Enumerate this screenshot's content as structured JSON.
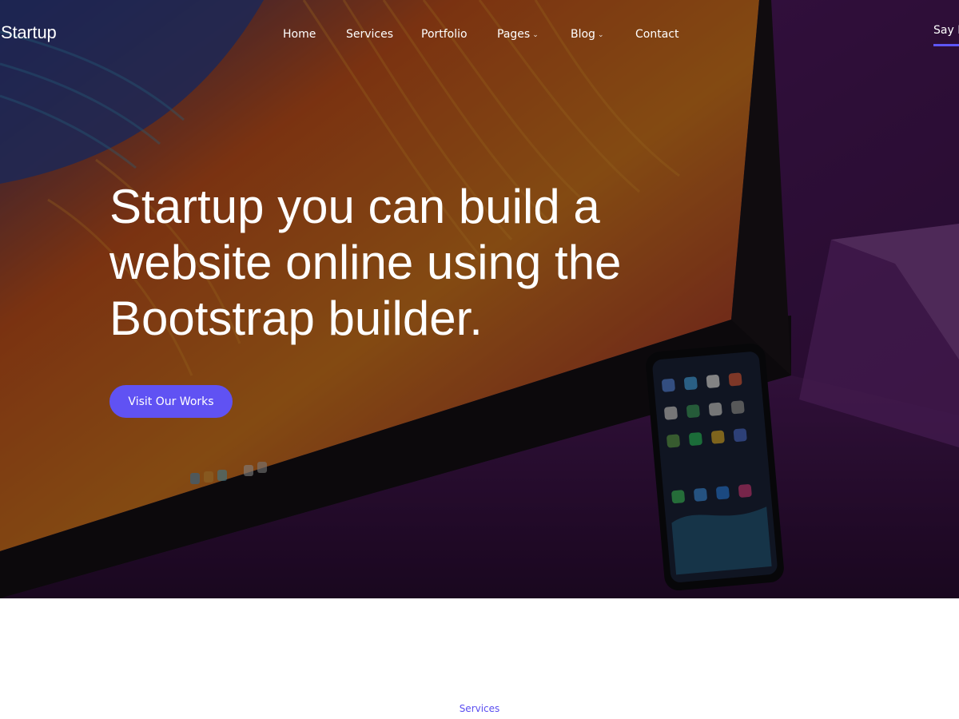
{
  "brand": {
    "name": "Startup"
  },
  "nav": {
    "items": [
      {
        "label": "Home",
        "has_dropdown": false
      },
      {
        "label": "Services",
        "has_dropdown": false
      },
      {
        "label": "Portfolio",
        "has_dropdown": false
      },
      {
        "label": "Pages",
        "has_dropdown": true
      },
      {
        "label": "Blog",
        "has_dropdown": true
      },
      {
        "label": "Contact",
        "has_dropdown": false
      }
    ],
    "cta_label": "Say Hi"
  },
  "hero": {
    "headline": "Startup you can build a website online using the Bootstrap builder.",
    "button_label": "Visit Our Works"
  },
  "next_section": {
    "eyebrow": "Services"
  },
  "colors": {
    "accent": "#6052f3",
    "nav_underline": "#5e56f5",
    "eyebrow_text": "#5a4df0",
    "hero_background": "#1f1420"
  }
}
